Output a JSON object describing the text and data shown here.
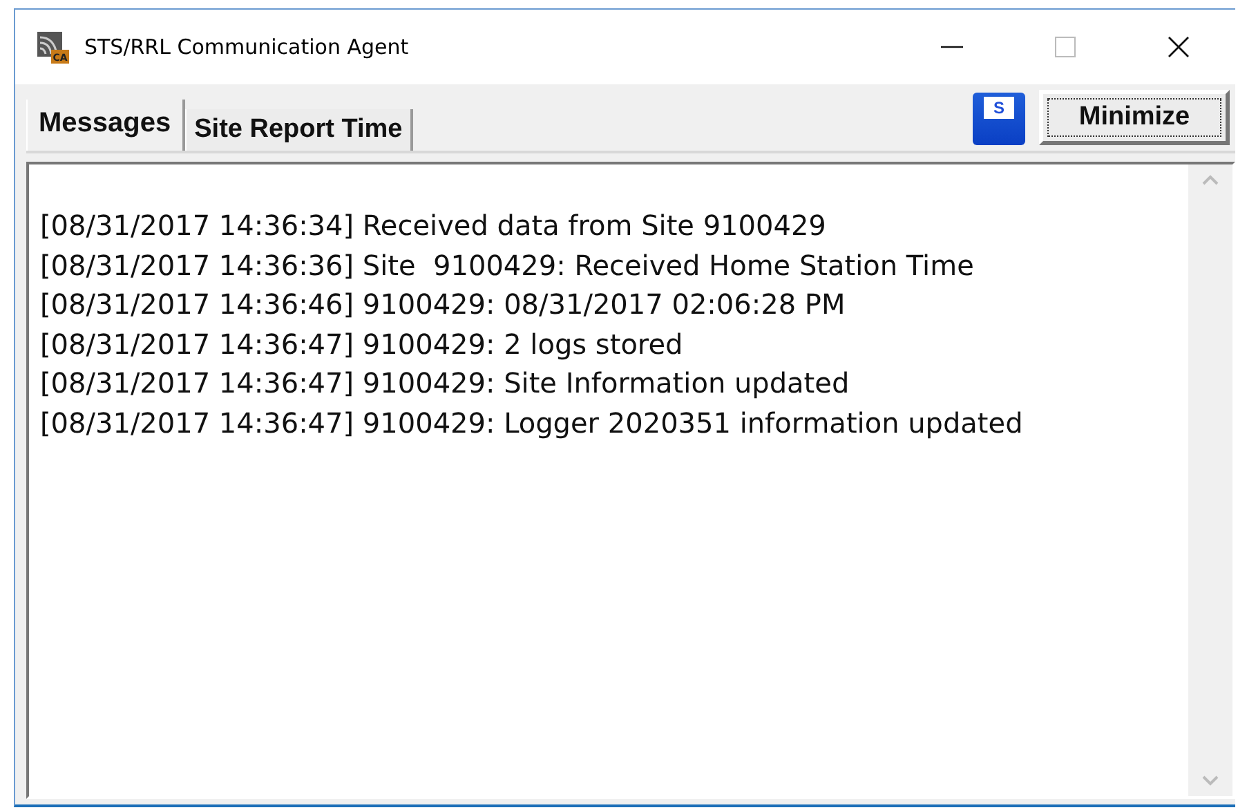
{
  "window": {
    "title": "STS/RRL Communication Agent",
    "app_icon_letters": "CA"
  },
  "tabs": [
    {
      "label": "Messages",
      "selected": true
    },
    {
      "label": "Site Report Time",
      "selected": false
    }
  ],
  "save_button": {
    "glyph": "S"
  },
  "minimize_button": {
    "label": "Minimize"
  },
  "messages": [
    "[08/31/2017 14:36:34] Received data from Site 9100429",
    "[08/31/2017 14:36:36] Site  9100429: Received Home Station Time",
    "[08/31/2017 14:36:46] 9100429: 08/31/2017 02:06:28 PM",
    "[08/31/2017 14:36:47] 9100429: 2 logs stored",
    "[08/31/2017 14:36:47] 9100429: Site Information updated",
    "[08/31/2017 14:36:47] 9100429: Logger 2020351 information updated"
  ]
}
